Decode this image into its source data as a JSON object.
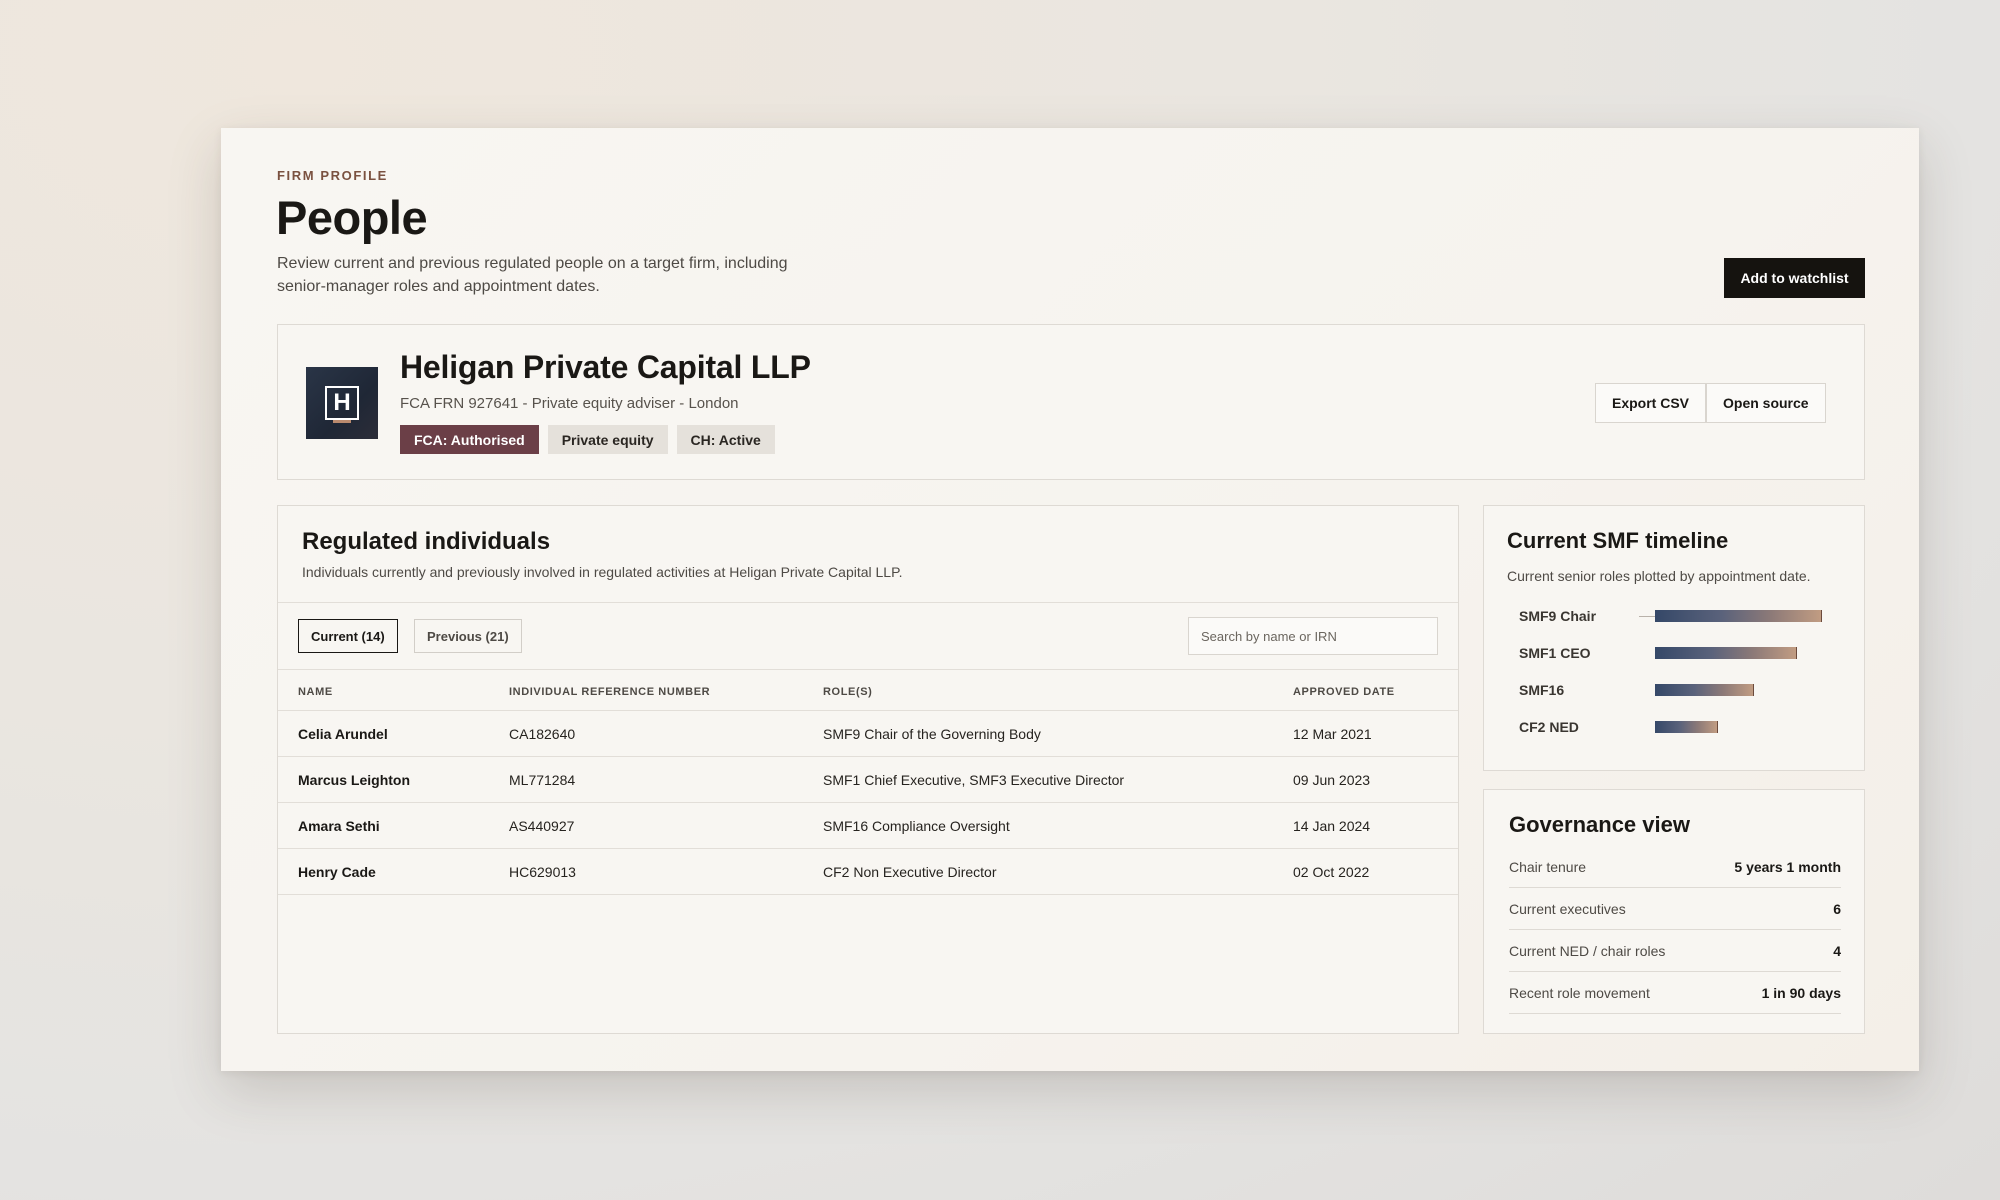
{
  "header": {
    "eyebrow": "FIRM PROFILE",
    "title": "People",
    "description": "Review current and previous regulated people on a target firm, including senior-manager roles and appointment dates.",
    "watchlist_label": "Add to watchlist"
  },
  "firm": {
    "logo_letter": "H",
    "name": "Heligan Private Capital LLP",
    "meta": "FCA FRN 927641 - Private equity adviser - London",
    "badges": [
      "FCA: Authorised",
      "Private equity",
      "CH: Active"
    ],
    "export_label": "Export CSV",
    "source_label": "Open source"
  },
  "individuals": {
    "title": "Regulated individuals",
    "subtitle": "Individuals currently and previously involved in regulated activities at Heligan Private Capital LLP.",
    "tabs": [
      {
        "label": "Current (14)",
        "active": true
      },
      {
        "label": "Previous (21)",
        "active": false
      }
    ],
    "search_placeholder": "Search by name or IRN",
    "columns": [
      "NAME",
      "INDIVIDUAL REFERENCE NUMBER",
      "ROLE(S)",
      "APPROVED DATE"
    ],
    "rows": [
      {
        "name": "Celia Arundel",
        "irn": "CA182640",
        "roles": "SMF9 Chair of the Governing Body",
        "date": "12 Mar 2021"
      },
      {
        "name": "Marcus Leighton",
        "irn": "ML771284",
        "roles": "SMF1 Chief Executive, SMF3 Executive Director",
        "date": "09 Jun 2023"
      },
      {
        "name": "Amara Sethi",
        "irn": "AS440927",
        "roles": "SMF16 Compliance Oversight",
        "date": "14 Jan 2024"
      },
      {
        "name": "Henry Cade",
        "irn": "HC629013",
        "roles": "CF2 Non Executive Director",
        "date": "02 Oct 2022"
      }
    ]
  },
  "timeline": {
    "title": "Current SMF timeline",
    "subtitle": "Current senior roles plotted by appointment date.",
    "items": [
      {
        "label": "SMF9 Chair",
        "length": 1.0
      },
      {
        "label": "SMF1 CEO",
        "length": 0.85
      },
      {
        "label": "SMF16",
        "length": 0.59
      },
      {
        "label": "CF2 NED",
        "length": 0.38
      }
    ]
  },
  "governance": {
    "title": "Governance view",
    "rows": [
      {
        "key": "Chair tenure",
        "value": "5 years 1 month"
      },
      {
        "key": "Current executives",
        "value": "6"
      },
      {
        "key": "Current NED / chair roles",
        "value": "4"
      },
      {
        "key": "Recent role movement",
        "value": "1 in 90 days"
      }
    ]
  },
  "colors": {
    "accent_dark": "#15130f",
    "badge_primary": "#6b3f47",
    "bar_start": "#354868",
    "bar_end": "#c19c82"
  }
}
